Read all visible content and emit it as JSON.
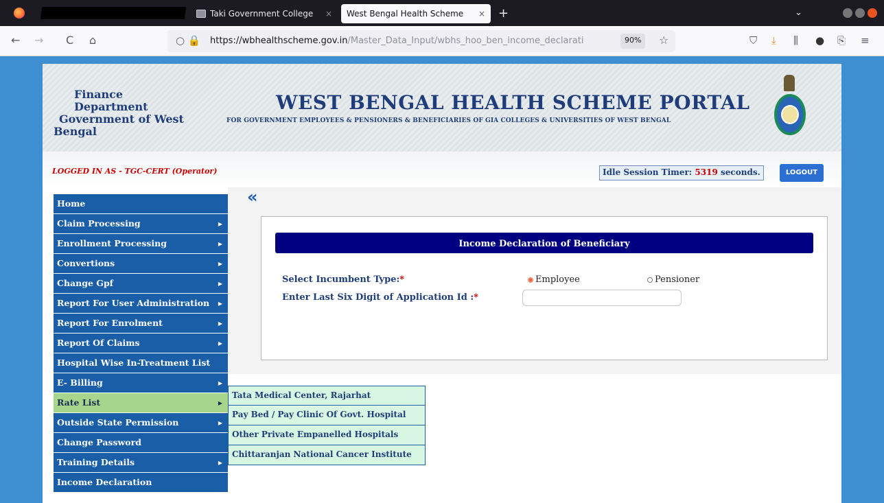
{
  "browser": {
    "tabs": [
      {
        "label": "Taki Government College",
        "close": "×"
      },
      {
        "label": "West Bengal Health Scheme",
        "close": "×"
      }
    ],
    "new_tab": "+",
    "tab_list": "⌄",
    "url_host": "https://wbhealthscheme.gov.in",
    "url_path": "/Master_Data_Input/wbhs_hoo_ben_income_declarati",
    "zoom": "90%",
    "nav": {
      "back": "←",
      "forward": "→",
      "reload": "C",
      "home": "⌂"
    },
    "toolbar": {
      "pocket": "⛉",
      "downloads": "⤓",
      "library": "⫼",
      "account": "●",
      "extensions": "⎘",
      "menu": "≡"
    },
    "security": "○ 🔒",
    "bookmark": "☆"
  },
  "header": {
    "dept_line1": "Finance Department",
    "dept_line2": "Government of West",
    "dept_line3": "Bengal",
    "title": "WEST BENGAL HEALTH SCHEME PORTAL",
    "subtitle": "FOR GOVERNMENT EMPLOYEES & PENSIONERS & BENEFICIARIES OF GIA COLLEGES & UNIVERSITIES OF WEST BENGAL"
  },
  "session": {
    "logged_in": "LOGGED IN AS - TGC-CERT (Operator)",
    "idle_label": "Idle Session Timer:",
    "idle_seconds": "5319",
    "idle_unit": "seconds.",
    "logout": "LOGOUT"
  },
  "collapse_icon": "«",
  "menu": [
    {
      "label": "Home",
      "arrow": ""
    },
    {
      "label": "Claim Processing",
      "arrow": "▶"
    },
    {
      "label": "Enrollment Processing",
      "arrow": "▶"
    },
    {
      "label": "Convertions",
      "arrow": "▶"
    },
    {
      "label": "Change Gpf",
      "arrow": "▶"
    },
    {
      "label": "Report For User Administration",
      "arrow": "▶"
    },
    {
      "label": "Report For Enrolment",
      "arrow": "▶"
    },
    {
      "label": "Report Of Claims",
      "arrow": "▶"
    },
    {
      "label": "Hospital Wise In-Treatment List",
      "arrow": ""
    },
    {
      "label": "E- Billing",
      "arrow": "▶"
    },
    {
      "label": "Rate List",
      "arrow": "▶"
    },
    {
      "label": "Outside State Permission",
      "arrow": "▶"
    },
    {
      "label": "Change Password",
      "arrow": ""
    },
    {
      "label": "Training Details",
      "arrow": "▶"
    },
    {
      "label": "Income Declaration",
      "arrow": ""
    }
  ],
  "submenu": [
    "Tata Medical Center, Rajarhat",
    "Pay Bed / Pay Clinic Of Govt. Hospital",
    "Other Private Empanelled Hospitals",
    "Chittaranjan National Cancer Institute"
  ],
  "form": {
    "heading": "Income Declaration of Beneficiary",
    "incumbent_label": "Select Incumbent Type:",
    "appid_label": "Enter Last Six Digit of Application Id :",
    "required_mark": "*",
    "option_employee": "Employee",
    "option_pensioner": "Pensioner",
    "appid_value": ""
  },
  "colors": {
    "menu_bg": "#1a5ea8",
    "menu_active": "#a6d68c",
    "panel_head": "#000080",
    "required": "#cc0000"
  }
}
